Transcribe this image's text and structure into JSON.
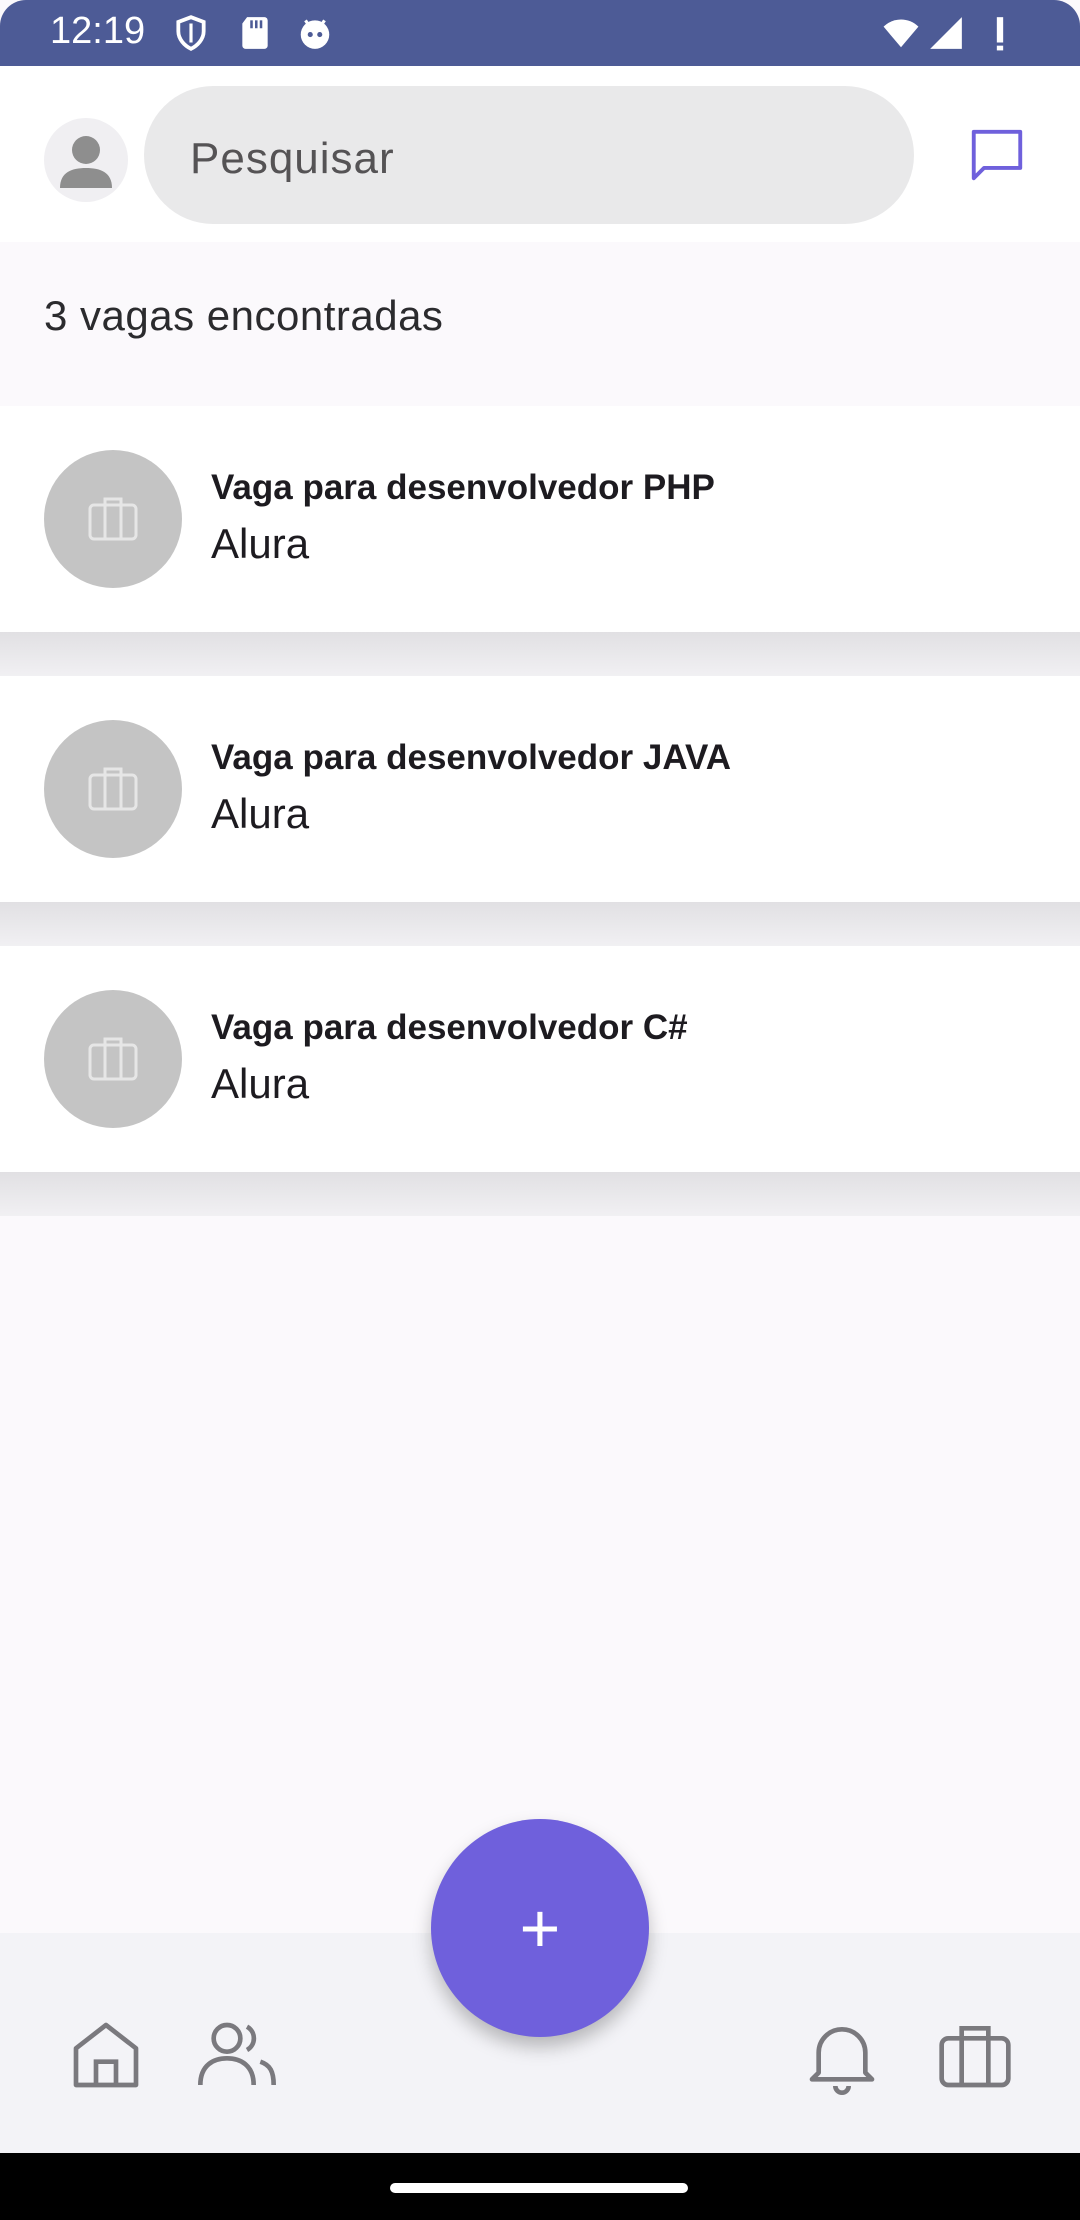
{
  "status_bar": {
    "time": "12:19",
    "icons": [
      "shield-icon",
      "sd-card-icon",
      "android-debug-icon",
      "wifi-icon",
      "signal-icon",
      "battery-icon"
    ],
    "background": "#4d5b96"
  },
  "header": {
    "avatar_icon": "person-icon",
    "search_placeholder": "Pesquisar",
    "message_icon": "chat-bubble-icon",
    "accent_color": "#6f60dc"
  },
  "results": {
    "count_label": "3 vagas encontradas"
  },
  "jobs": [
    {
      "title": "Vaga para desenvolvedor PHP",
      "company": "Alura",
      "icon": "briefcase-icon"
    },
    {
      "title": "Vaga para desenvolvedor JAVA",
      "company": "Alura",
      "icon": "briefcase-icon"
    },
    {
      "title": "Vaga para desenvolvedor C#",
      "company": "Alura",
      "icon": "briefcase-icon"
    }
  ],
  "bottom_nav": {
    "items": [
      "home-icon",
      "people-icon",
      "bell-icon",
      "briefcase-icon"
    ],
    "fab_label": "+",
    "fab_color": "#6f60dc"
  }
}
